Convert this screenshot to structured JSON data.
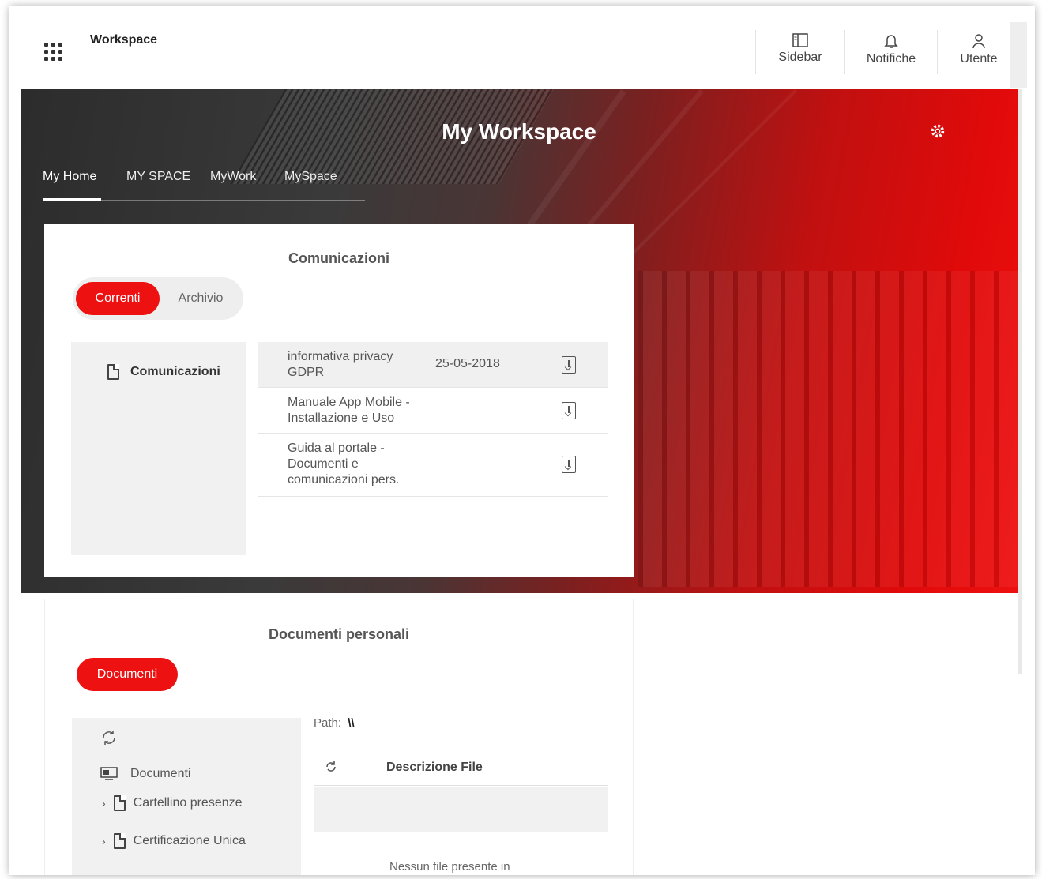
{
  "app": {
    "title": "Workspace",
    "actions": [
      {
        "label": "Sidebar",
        "icon": "sidebar-icon"
      },
      {
        "label": "Notifiche",
        "icon": "bell-icon"
      },
      {
        "label": "Utente",
        "icon": "user-icon"
      }
    ]
  },
  "hero": {
    "title": "My Workspace",
    "tabs": [
      "My Home",
      "MY SPACE",
      "MyWork",
      "MySpace"
    ],
    "active_tab": "My Home"
  },
  "communications": {
    "title": "Comunicazioni",
    "toggle": {
      "current": "Correnti",
      "archive": "Archivio"
    },
    "folder": "Comunicazioni",
    "items": [
      {
        "name": "informativa privacy GDPR",
        "date": "25-05-2018"
      },
      {
        "name": "Manuale App Mobile - Installazione e Uso",
        "date": ""
      },
      {
        "name": "Guida al portale - Documenti e comunicazioni pers.",
        "date": ""
      }
    ]
  },
  "documents": {
    "title": "Documenti personali",
    "tab": "Documenti",
    "path_label": "Path:",
    "path_value": "\\\\",
    "column": "Descrizione File",
    "tree_root": "Documenti",
    "tree": [
      "Cartellino presenze",
      "Certificazione Unica"
    ],
    "empty_text": "Nessun file presente in"
  },
  "colors": {
    "accent": "#ee1111",
    "panel": "#f1f1f1"
  }
}
